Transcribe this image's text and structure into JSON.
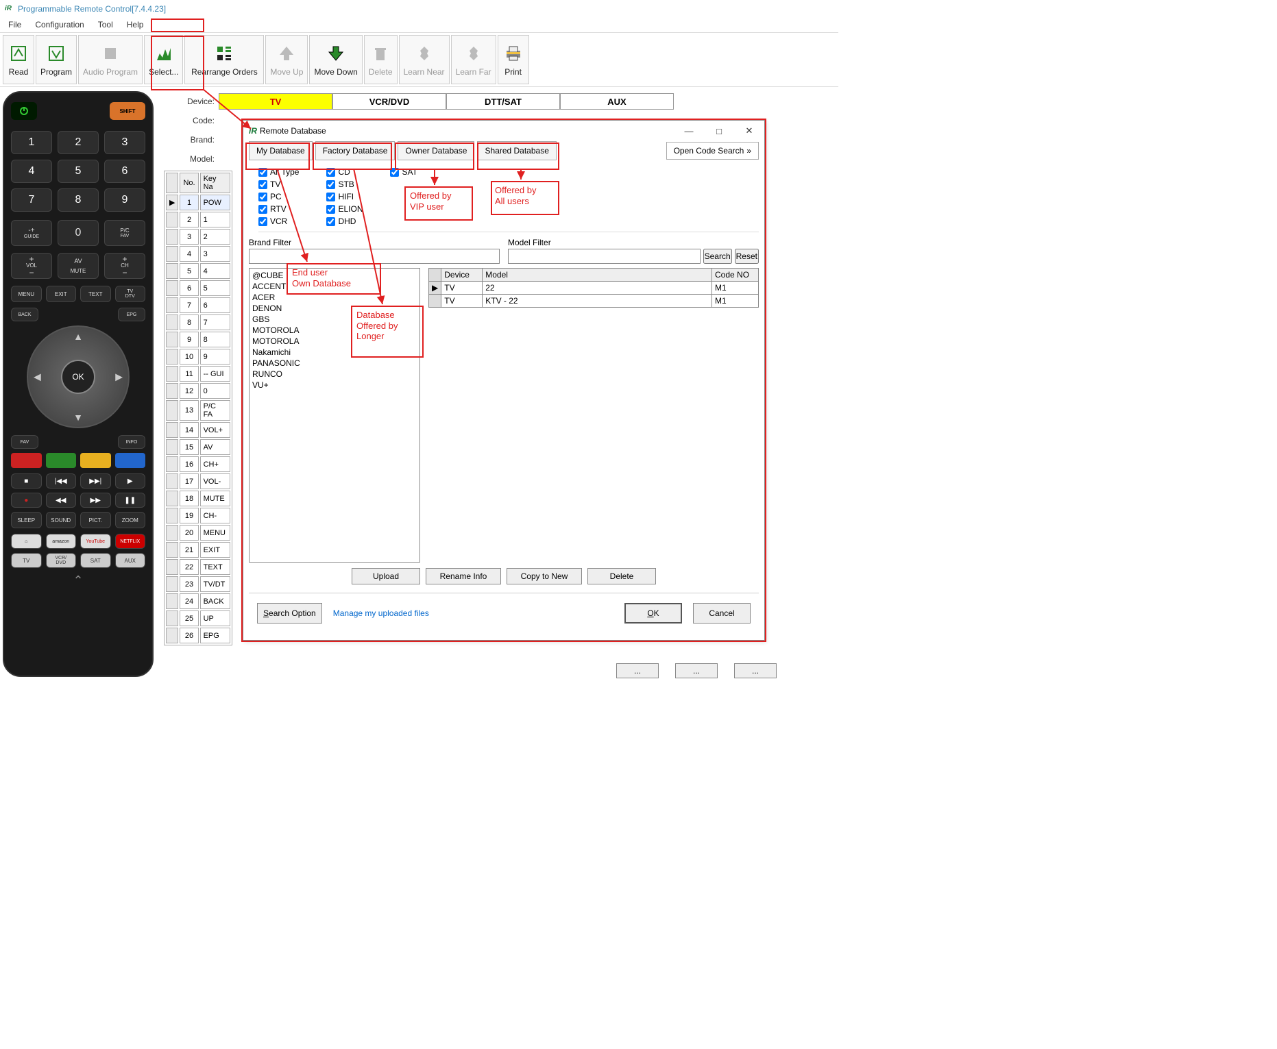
{
  "title": "Programmable Remote Control[7.4.4.23]",
  "menu": [
    "File",
    "Configuration",
    "Tool",
    "Help"
  ],
  "toolbar": [
    {
      "label": "Read",
      "disabled": false
    },
    {
      "label": "Program",
      "disabled": false
    },
    {
      "label": "Audio Program",
      "disabled": true
    },
    {
      "label": "Select...",
      "disabled": false
    },
    {
      "label": "Rearrange Orders",
      "disabled": false
    },
    {
      "label": "Move Up",
      "disabled": true
    },
    {
      "label": "Move Down",
      "disabled": false
    },
    {
      "label": "Delete",
      "disabled": true
    },
    {
      "label": "Learn Near",
      "disabled": true
    },
    {
      "label": "Learn Far",
      "disabled": true
    },
    {
      "label": "Print",
      "disabled": false
    }
  ],
  "fields": {
    "device": "Device:",
    "code": "Code:",
    "brand": "Brand:",
    "model": "Model:"
  },
  "deviceTabs": [
    "TV",
    "VCR/DVD",
    "DTT/SAT",
    "AUX"
  ],
  "keyCols": {
    "no": "No.",
    "name": "Key Na"
  },
  "keyRows": [
    {
      "n": "1",
      "k": "POW",
      "sel": true
    },
    {
      "n": "2",
      "k": "1"
    },
    {
      "n": "3",
      "k": "2"
    },
    {
      "n": "4",
      "k": "3"
    },
    {
      "n": "5",
      "k": "4"
    },
    {
      "n": "6",
      "k": "5"
    },
    {
      "n": "7",
      "k": "6"
    },
    {
      "n": "8",
      "k": "7"
    },
    {
      "n": "9",
      "k": "8"
    },
    {
      "n": "10",
      "k": "9"
    },
    {
      "n": "11",
      "k": "-- GUI"
    },
    {
      "n": "12",
      "k": "0"
    },
    {
      "n": "13",
      "k": "P/C FA"
    },
    {
      "n": "14",
      "k": "VOL+"
    },
    {
      "n": "15",
      "k": "AV"
    },
    {
      "n": "16",
      "k": "CH+"
    },
    {
      "n": "17",
      "k": "VOL-"
    },
    {
      "n": "18",
      "k": "MUTE"
    },
    {
      "n": "19",
      "k": "CH-"
    },
    {
      "n": "20",
      "k": "MENU"
    },
    {
      "n": "21",
      "k": "EXIT"
    },
    {
      "n": "22",
      "k": "TEXT"
    },
    {
      "n": "23",
      "k": "TV/DT"
    },
    {
      "n": "24",
      "k": "BACK"
    },
    {
      "n": "25",
      "k": "UP"
    },
    {
      "n": "26",
      "k": "EPG"
    }
  ],
  "dialog": {
    "title": "Remote Database",
    "tabs": [
      "My Database",
      "Factory Database",
      "Owner Database",
      "Shared Database"
    ],
    "openCode": "Open Code Search",
    "types": {
      "col1": [
        "All Type",
        "TV",
        "PC",
        "RTV",
        "VCR"
      ],
      "col2": [
        "CD",
        "STB",
        "HIFI",
        "ELION",
        "DHD"
      ],
      "col3": [
        "SAT"
      ]
    },
    "brandFilter": "Brand Filter",
    "modelFilter": "Model Filter",
    "search": "Search",
    "reset": "Reset",
    "brands": [
      "@CUBE",
      "ACCENT",
      "ACER",
      "DENON",
      "GBS",
      "MOTOROLA",
      "MOTOROLA",
      "Nakamichi",
      "PANASONIC",
      "RUNCO",
      "VU+"
    ],
    "modelCols": {
      "device": "Device",
      "model": "Model",
      "code": "Code NO"
    },
    "models": [
      {
        "device": "TV",
        "model": "22",
        "code": "M1"
      },
      {
        "device": "TV",
        "model": "KTV - 22",
        "code": "M1"
      }
    ],
    "actions": {
      "upload": "Upload",
      "rename": "Rename Info",
      "copy": "Copy to New",
      "delete": "Delete"
    },
    "searchOption": "Search Option",
    "manageLink": "Manage my uploaded files",
    "ok": "OK",
    "cancel": "Cancel"
  },
  "annotations": {
    "endUser": "End user\nOwn Database",
    "factory": "Database\nOffered by\nLonger",
    "owner": "Offered by\nVIP user",
    "shared": "Offered by\nAll users"
  },
  "remote": {
    "shift": "SHIFT",
    "guide": "GUIDE",
    "pc": "P/C",
    "fav": "FAV",
    "vol": "VOL",
    "av": "AV",
    "ch": "CH",
    "mute": "MUTE",
    "menu": "MENU",
    "exit": "EXIT",
    "text": "TEXT",
    "tvdtv": "TV\nDTV",
    "back": "BACK",
    "epg": "EPG",
    "info": "INFO",
    "ok": "OK",
    "sleep": "SLEEP",
    "sound": "SOUND",
    "pict": "PICT.",
    "zoom": "ZOOM",
    "svc": [
      "amazon",
      "YouTube",
      "NETFLIX"
    ],
    "tv": "TV",
    "vcrdvd": "VCR/\nDVD",
    "sat": "SAT",
    "aux": "AUX"
  }
}
